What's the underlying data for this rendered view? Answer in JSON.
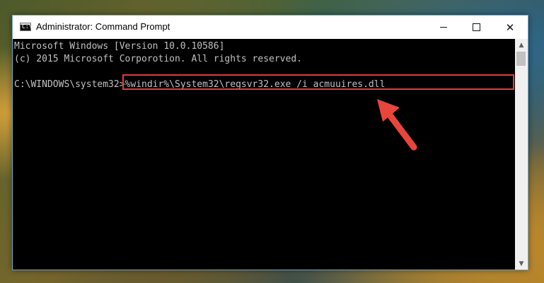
{
  "window": {
    "title": "Administrator: Command Prompt",
    "icon": "cmd-icon",
    "icon_glyph": "C:\\"
  },
  "controls": {
    "minimize": "minimize-icon",
    "maximize": "maximize-icon",
    "close": "close-icon",
    "close_glyph": "✕"
  },
  "console": {
    "lines": [
      "Microsoft Windows [Version 10.0.10586]",
      "(c) 2015 Microsoft Corporotion. All rights reserved.",
      ""
    ],
    "prompt": "C:\\WINDOWS\\system32>",
    "command": "%windir%\\System32\\regsvr32.exe /i acmuuires.dll"
  },
  "scrollbar": {
    "up_glyph": "▲",
    "down_glyph": "▼"
  },
  "annotation": {
    "highlight_color": "#e13b3b",
    "arrow_color": "#e8453c"
  }
}
